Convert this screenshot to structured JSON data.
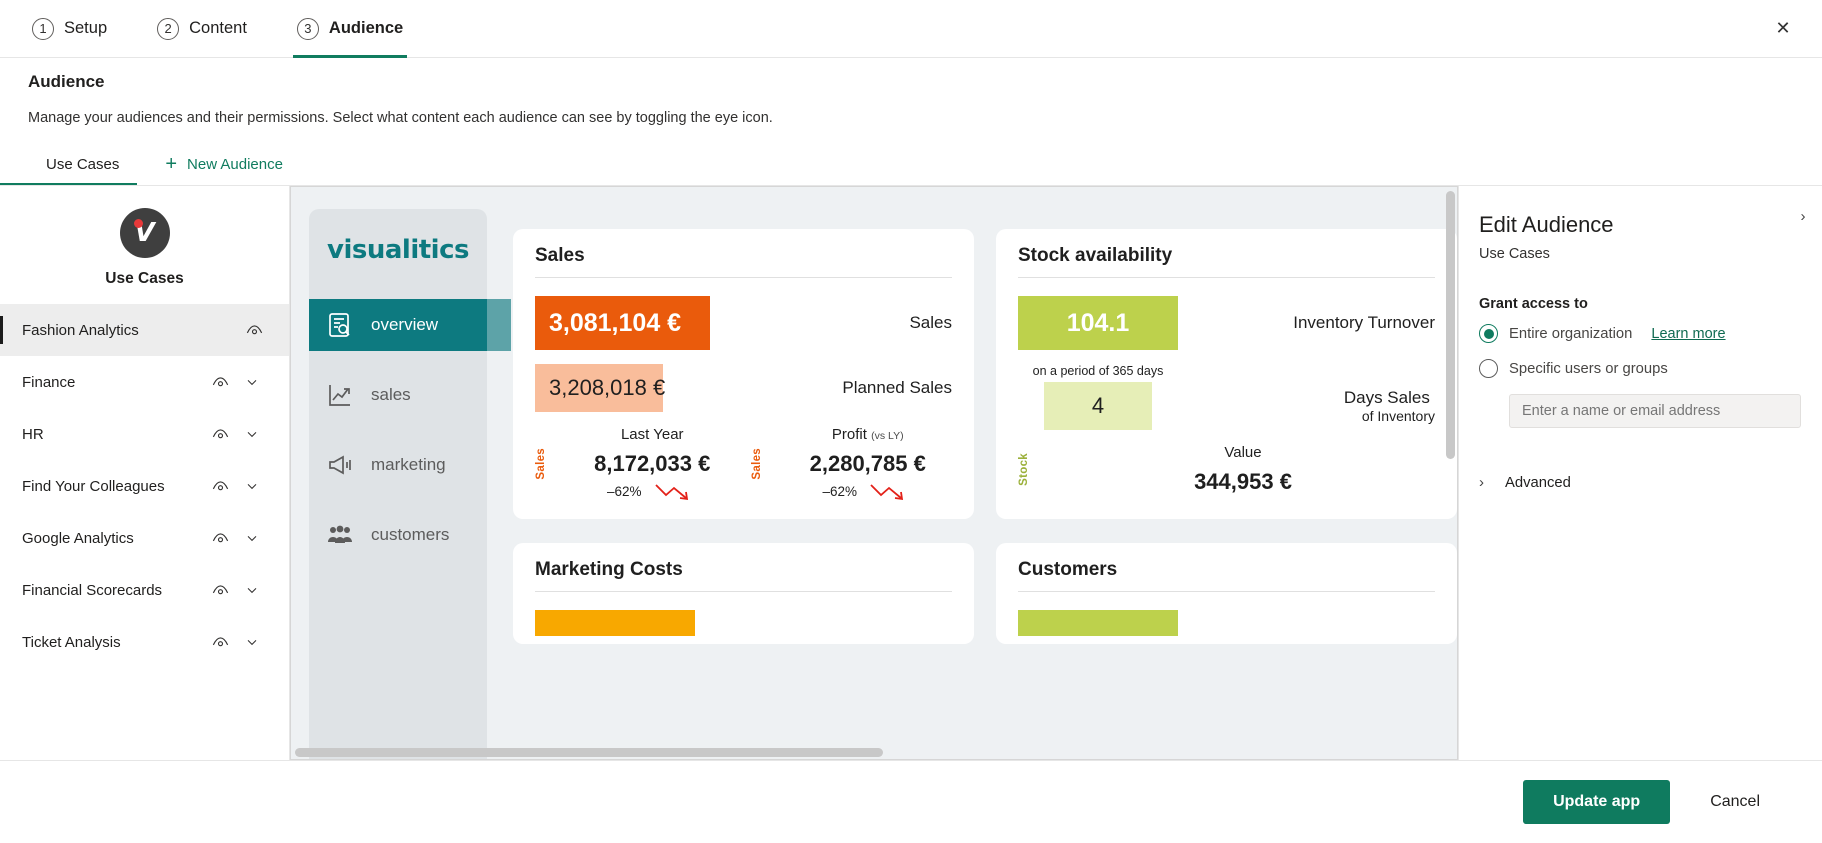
{
  "wizard": {
    "steps": [
      {
        "num": "1",
        "label": "Setup",
        "active": false
      },
      {
        "num": "2",
        "label": "Content",
        "active": false
      },
      {
        "num": "3",
        "label": "Audience",
        "active": true
      }
    ],
    "close_icon": "✕"
  },
  "page": {
    "title": "Audience",
    "description": "Manage your audiences and their permissions. Select what content each audience can see by toggling the eye icon."
  },
  "tabs": {
    "use_cases": "Use Cases",
    "new_audience": "New Audience",
    "plus": "+"
  },
  "audience_list": {
    "brand_name": "Use Cases",
    "brand_letter": "V",
    "items": [
      {
        "label": "Fashion Analytics",
        "selected": true,
        "has_chevron": false
      },
      {
        "label": "Finance",
        "selected": false,
        "has_chevron": true
      },
      {
        "label": "HR",
        "selected": false,
        "has_chevron": true
      },
      {
        "label": "Find Your Colleagues",
        "selected": false,
        "has_chevron": true
      },
      {
        "label": "Google Analytics",
        "selected": false,
        "has_chevron": true
      },
      {
        "label": "Financial Scorecards",
        "selected": false,
        "has_chevron": true
      },
      {
        "label": "Ticket Analysis",
        "selected": false,
        "has_chevron": true
      }
    ]
  },
  "preview": {
    "logo": "visualitics",
    "nav": [
      {
        "label": "overview",
        "icon": "report-search-icon",
        "active": true
      },
      {
        "label": "sales",
        "icon": "line-chart-icon",
        "active": false
      },
      {
        "label": "marketing",
        "icon": "megaphone-icon",
        "active": false
      },
      {
        "label": "customers",
        "icon": "people-icon",
        "active": false
      }
    ],
    "cards": {
      "sales": {
        "title": "Sales",
        "primary_value": "3,081,104 €",
        "primary_caption": "Sales",
        "secondary_value": "3,208,018 €",
        "secondary_caption": "Planned Sales",
        "metrics": [
          {
            "axis": "Sales",
            "head": "Last Year",
            "vs": "",
            "value": "8,172,033 €",
            "pct": "–62%"
          },
          {
            "axis": "Sales",
            "head": "Profit",
            "vs": "(vs LY)",
            "value": "2,280,785 €",
            "pct": "–62%"
          }
        ]
      },
      "stock": {
        "title": "Stock availability",
        "primary_value": "104.1",
        "primary_caption": "Inventory Turnover",
        "period_note": "on a period of 365 days",
        "secondary_value": "4",
        "secondary_caption": "Days Sales",
        "secondary_caption_sub": "of Inventory",
        "metrics": [
          {
            "axis": "Stock",
            "head": "Value",
            "vs": "",
            "value": "344,953 €",
            "pct": ""
          }
        ]
      },
      "marketing": {
        "title": "Marketing Costs"
      },
      "customers": {
        "title": "Customers"
      }
    },
    "colors": {
      "brand_teal": "#0d7a80",
      "orange": "#ea5b0c",
      "orange_light": "#f9bd9b",
      "green": "#bdd14c",
      "green_light": "#e6eeb7",
      "amber": "#f8a800",
      "red": "#e32119"
    }
  },
  "edit_panel": {
    "title": "Edit Audience",
    "subtitle": "Use Cases",
    "field_label": "Grant access to",
    "options": [
      {
        "label": "Entire organization",
        "selected": true
      },
      {
        "label": "Specific users or groups",
        "selected": false
      }
    ],
    "learn_more": "Learn more",
    "input_placeholder": "Enter a name or email address",
    "input_value": "",
    "advanced_label": "Advanced",
    "expand_icon": "›",
    "advanced_chevron": "›"
  },
  "footer": {
    "primary": "Update app",
    "secondary": "Cancel"
  }
}
